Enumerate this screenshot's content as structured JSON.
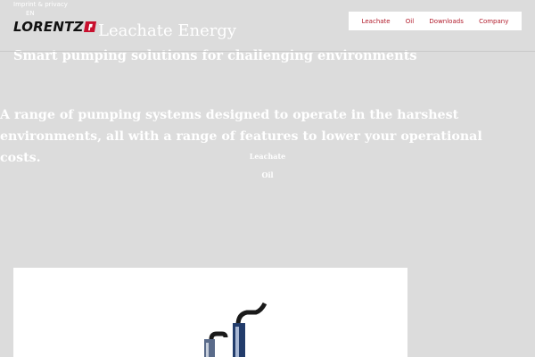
{
  "header": {
    "topline": "Imprint & privacy",
    "topline_sub": "EN",
    "logo_text": "LORENTZ",
    "hero_title": "Leachate Energy",
    "hero_subtitle": "Smart pumping solutions for challenging environments"
  },
  "nav": {
    "items": [
      "Leachate",
      "Oil",
      "Downloads",
      "Company"
    ]
  },
  "main": {
    "intro": "A range of pumping systems designed to operate in the harshest environments, all with a range of features to lower your operational costs.",
    "links": [
      "Leachate",
      "Oil"
    ]
  },
  "colors": {
    "background": "#dcdcdc",
    "brand_red": "#c8102e",
    "nav_link": "#b11a2a"
  }
}
